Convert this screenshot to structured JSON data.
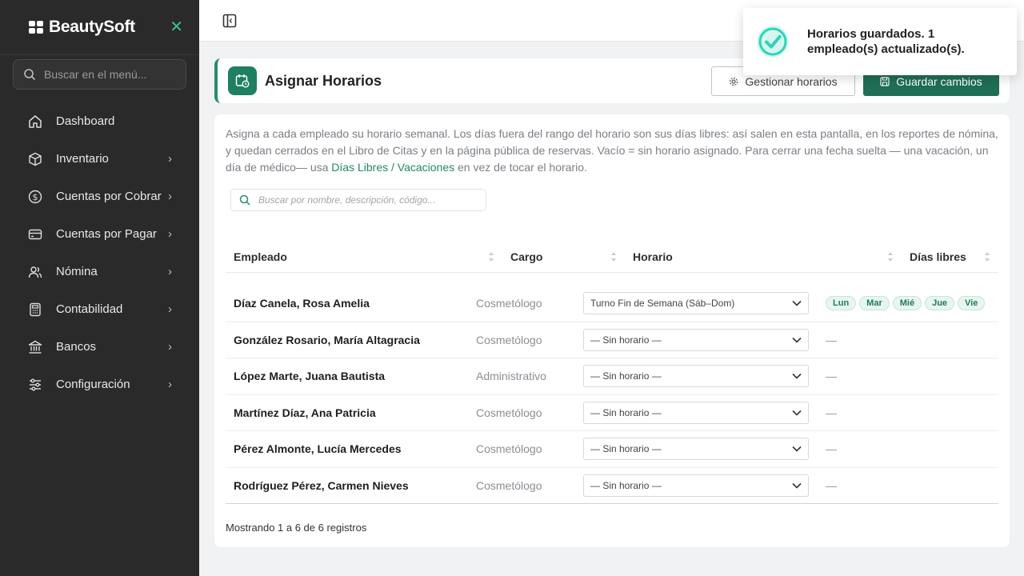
{
  "app": {
    "brand": "BeautySoft"
  },
  "sidebar": {
    "search_placeholder": "Buscar en el menú...",
    "items": [
      {
        "label": "Dashboard",
        "icon": "home-icon",
        "has_children": false
      },
      {
        "label": "Inventario",
        "icon": "box-icon",
        "has_children": true
      },
      {
        "label": "Cuentas por Cobrar",
        "icon": "dollar-circle-icon",
        "has_children": true
      },
      {
        "label": "Cuentas por Pagar",
        "icon": "credit-card-icon",
        "has_children": true
      },
      {
        "label": "Nómina",
        "icon": "users-icon",
        "has_children": true
      },
      {
        "label": "Contabilidad",
        "icon": "calculator-icon",
        "has_children": true
      },
      {
        "label": "Bancos",
        "icon": "bank-icon",
        "has_children": true
      },
      {
        "label": "Configuración",
        "icon": "sliders-icon",
        "has_children": true
      }
    ]
  },
  "header": {
    "title": "Asignar Horarios",
    "manage_label": "Gestionar horarios",
    "save_label": "Guardar cambios"
  },
  "main": {
    "description_before": "Asigna a cada empleado su horario semanal. Los días fuera del rango del horario son sus días libres: así salen en esta pantalla, en los reportes de nómina, y quedan cerrados en el Libro de Citas y en la página pública de reservas. Vacío = sin horario asignado. Para cerrar una fecha suelta — una vacación, un día de médico— usa ",
    "description_link": "Días Libres / Vacaciones",
    "description_after": " en vez de tocar el horario.",
    "search_placeholder": "Buscar por nombre, descripción, código...",
    "columns": [
      "Empleado",
      "Cargo",
      "Horario",
      "Días libres"
    ],
    "rows": [
      {
        "name": "Díaz Canela, Rosa Amelia",
        "cargo": "Cosmetólogo",
        "horario": "Turno Fin de Semana (Sáb–Dom)",
        "libres": [
          "Lun",
          "Mar",
          "Mié",
          "Jue",
          "Vie"
        ]
      },
      {
        "name": "González Rosario, María Altagracia",
        "cargo": "Cosmetólogo",
        "horario": "— Sin horario —",
        "libres_text": "—"
      },
      {
        "name": "López Marte, Juana Bautista",
        "cargo": "Administrativo",
        "horario": "— Sin horario —",
        "libres_text": "—"
      },
      {
        "name": "Martínez Díaz, Ana Patricia",
        "cargo": "Cosmetólogo",
        "horario": "— Sin horario —",
        "libres_text": "—"
      },
      {
        "name": "Pérez Almonte, Lucía Mercedes",
        "cargo": "Cosmetólogo",
        "horario": "— Sin horario —",
        "libres_text": "—"
      },
      {
        "name": "Rodríguez Pérez, Carmen Nieves",
        "cargo": "Cosmetólogo",
        "horario": "— Sin horario —",
        "libres_text": "—"
      }
    ],
    "footer": "Mostrando 1 a 6 de 6 registros"
  },
  "toast": {
    "message": "Horarios guardados. 1 empleado(s) actualizado(s).",
    "icon": "check-circle-icon"
  },
  "colors": {
    "sidebar_bg": "#2a2a2a",
    "accent": "#1e6f55",
    "toast_check": "#2ed3b7"
  }
}
